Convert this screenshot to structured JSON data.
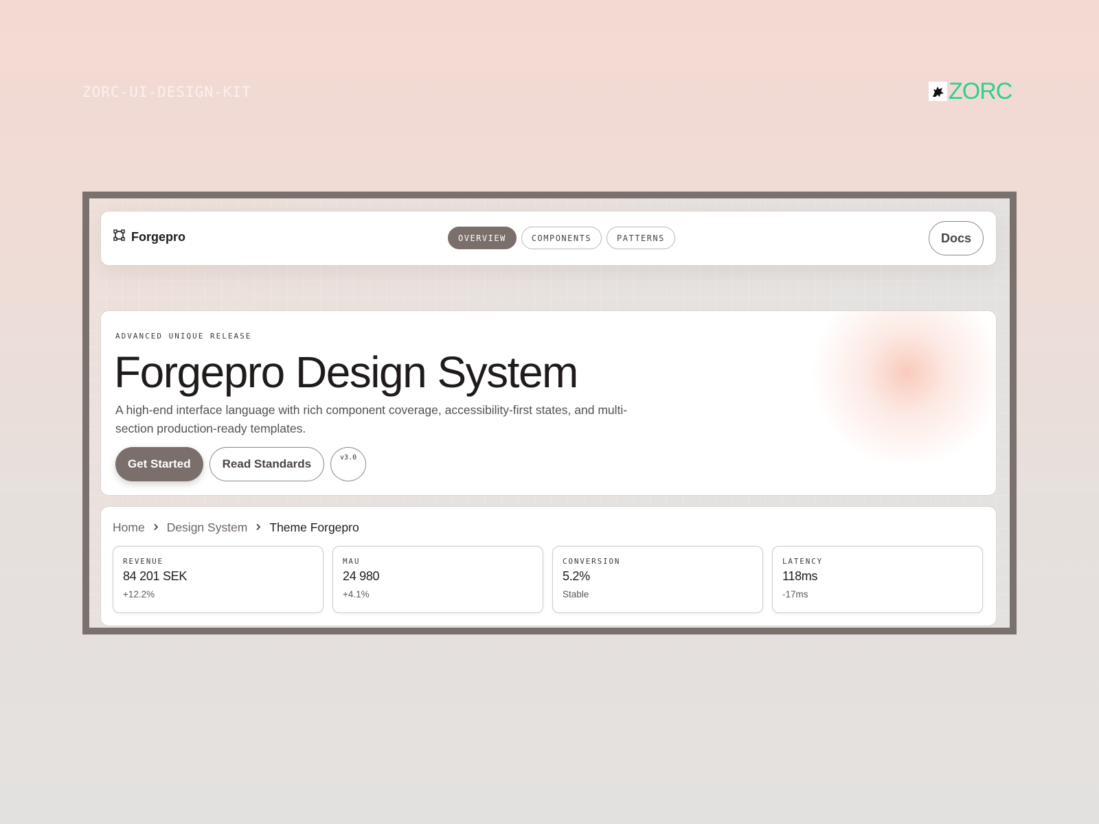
{
  "page": {
    "kit_label": "ZORC-UI-DESIGN-KIT",
    "brand": {
      "name": "ZORC",
      "icon": "wolf-logo-icon",
      "color": "#2fcf91"
    }
  },
  "navbar": {
    "brand_icon": "frame-nodes-icon",
    "brand_name": "Forgepro",
    "tabs": [
      {
        "label": "OVERVIEW",
        "active": true
      },
      {
        "label": "COMPONENTS",
        "active": false
      },
      {
        "label": "PATTERNS",
        "active": false
      }
    ],
    "docs_label": "Docs"
  },
  "hero": {
    "eyebrow": "ADVANCED UNIQUE RELEASE",
    "title": "Forgepro Design System",
    "description": "A high-end interface language with rich component coverage, accessibility-first states, and multi-section production-ready templates.",
    "primary_label": "Get Started",
    "secondary_label": "Read Standards",
    "version": "v3.0"
  },
  "breadcrumb": {
    "items": [
      "Home",
      "Design System",
      "Theme Forgepro"
    ],
    "separator_icon": "chevron-right-icon"
  },
  "metrics": [
    {
      "label": "REVENUE",
      "value": "84 201 SEK",
      "delta": "+12.2%"
    },
    {
      "label": "MAU",
      "value": "24 980",
      "delta": "+4.1%"
    },
    {
      "label": "CONVERSION",
      "value": "5.2%",
      "delta": "Stable"
    },
    {
      "label": "LATENCY",
      "value": "118ms",
      "delta": "-17ms"
    }
  ],
  "colors": {
    "accent": "#7a6f6b",
    "frame": "#7a716e",
    "glow": "#f9c8b9"
  }
}
